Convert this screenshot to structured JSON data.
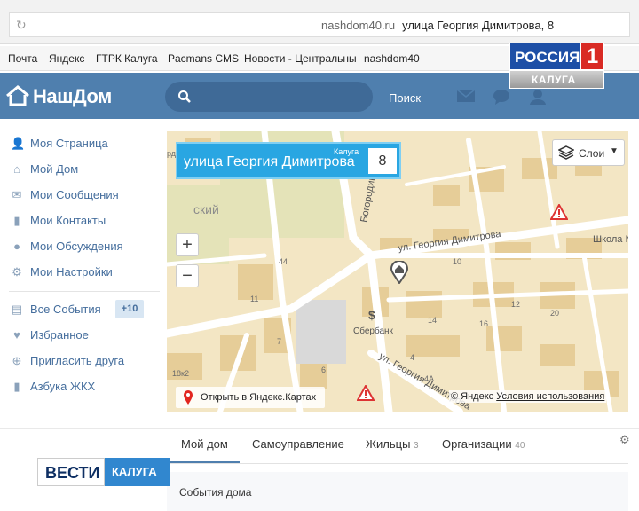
{
  "browser": {
    "domain": "nashdom40.ru",
    "page_title": "улица Георгия Димитрова, 8",
    "bookmarks": [
      "Почта",
      "Яндекс",
      "ГТРК Калуга",
      "Pacmans CMS",
      "Новости - Центральны",
      "nashdom40"
    ]
  },
  "header": {
    "logo": "НашДом",
    "search_placeholder": "",
    "search_button": "Поиск"
  },
  "sidebar": {
    "items": [
      {
        "label": "Моя Страница",
        "icon": "user-icon"
      },
      {
        "label": "Мой Дом",
        "icon": "home-icon"
      },
      {
        "label": "Мои Сообщения",
        "icon": "envelope-icon"
      },
      {
        "label": "Мои Контакты",
        "icon": "book-icon"
      },
      {
        "label": "Мои Обсуждения",
        "icon": "comment-icon"
      },
      {
        "label": "Мои Настройки",
        "icon": "gear-icon"
      },
      {
        "label": "Все События",
        "icon": "newspaper-icon",
        "badge": "+10"
      },
      {
        "label": "Избранное",
        "icon": "heart-icon"
      },
      {
        "label": "Пригласить друга",
        "icon": "plus-circle-icon"
      },
      {
        "label": "Азбука ЖКХ",
        "icon": "book-icon"
      }
    ]
  },
  "map": {
    "address_city": "Калуга",
    "address_street": "улица Георгия Димитрова",
    "address_number": "8",
    "layers_label": "Слои",
    "zoom_in": "+",
    "zoom_out": "−",
    "open_yandex": "Открыть в Яндекс.Картах",
    "copyright": "© Яндекс",
    "terms": "Условия использования",
    "labels": {
      "street_1": "ул. Георгия Димитрова",
      "street_2": "ул. Георгия Димитрова",
      "bogorod": "Богородиц",
      "sky": "ский",
      "school": "Школа №",
      "sberbank": "Сбербанк",
      "rd": "рд",
      "n44": "44",
      "n11": "11",
      "n10": "10",
      "n14": "14",
      "n16": "16",
      "n12": "12",
      "n20": "20",
      "n4": "4",
      "n4a": "4А",
      "n6": "6",
      "n18k2": "18к2",
      "n7": "7"
    }
  },
  "tabs": [
    {
      "label": "Мой дом",
      "count": ""
    },
    {
      "label": "Самоуправление",
      "count": ""
    },
    {
      "label": "Жильцы",
      "count": "3"
    },
    {
      "label": "Организации",
      "count": "40"
    }
  ],
  "events_title": "События дома",
  "logos": {
    "rossiya": "РОССИЯ",
    "rossiya_num": "1",
    "rossiya_sub": "КАЛУГА",
    "vesti": "ВЕСТИ",
    "vesti_sub": "КАЛУГА"
  }
}
